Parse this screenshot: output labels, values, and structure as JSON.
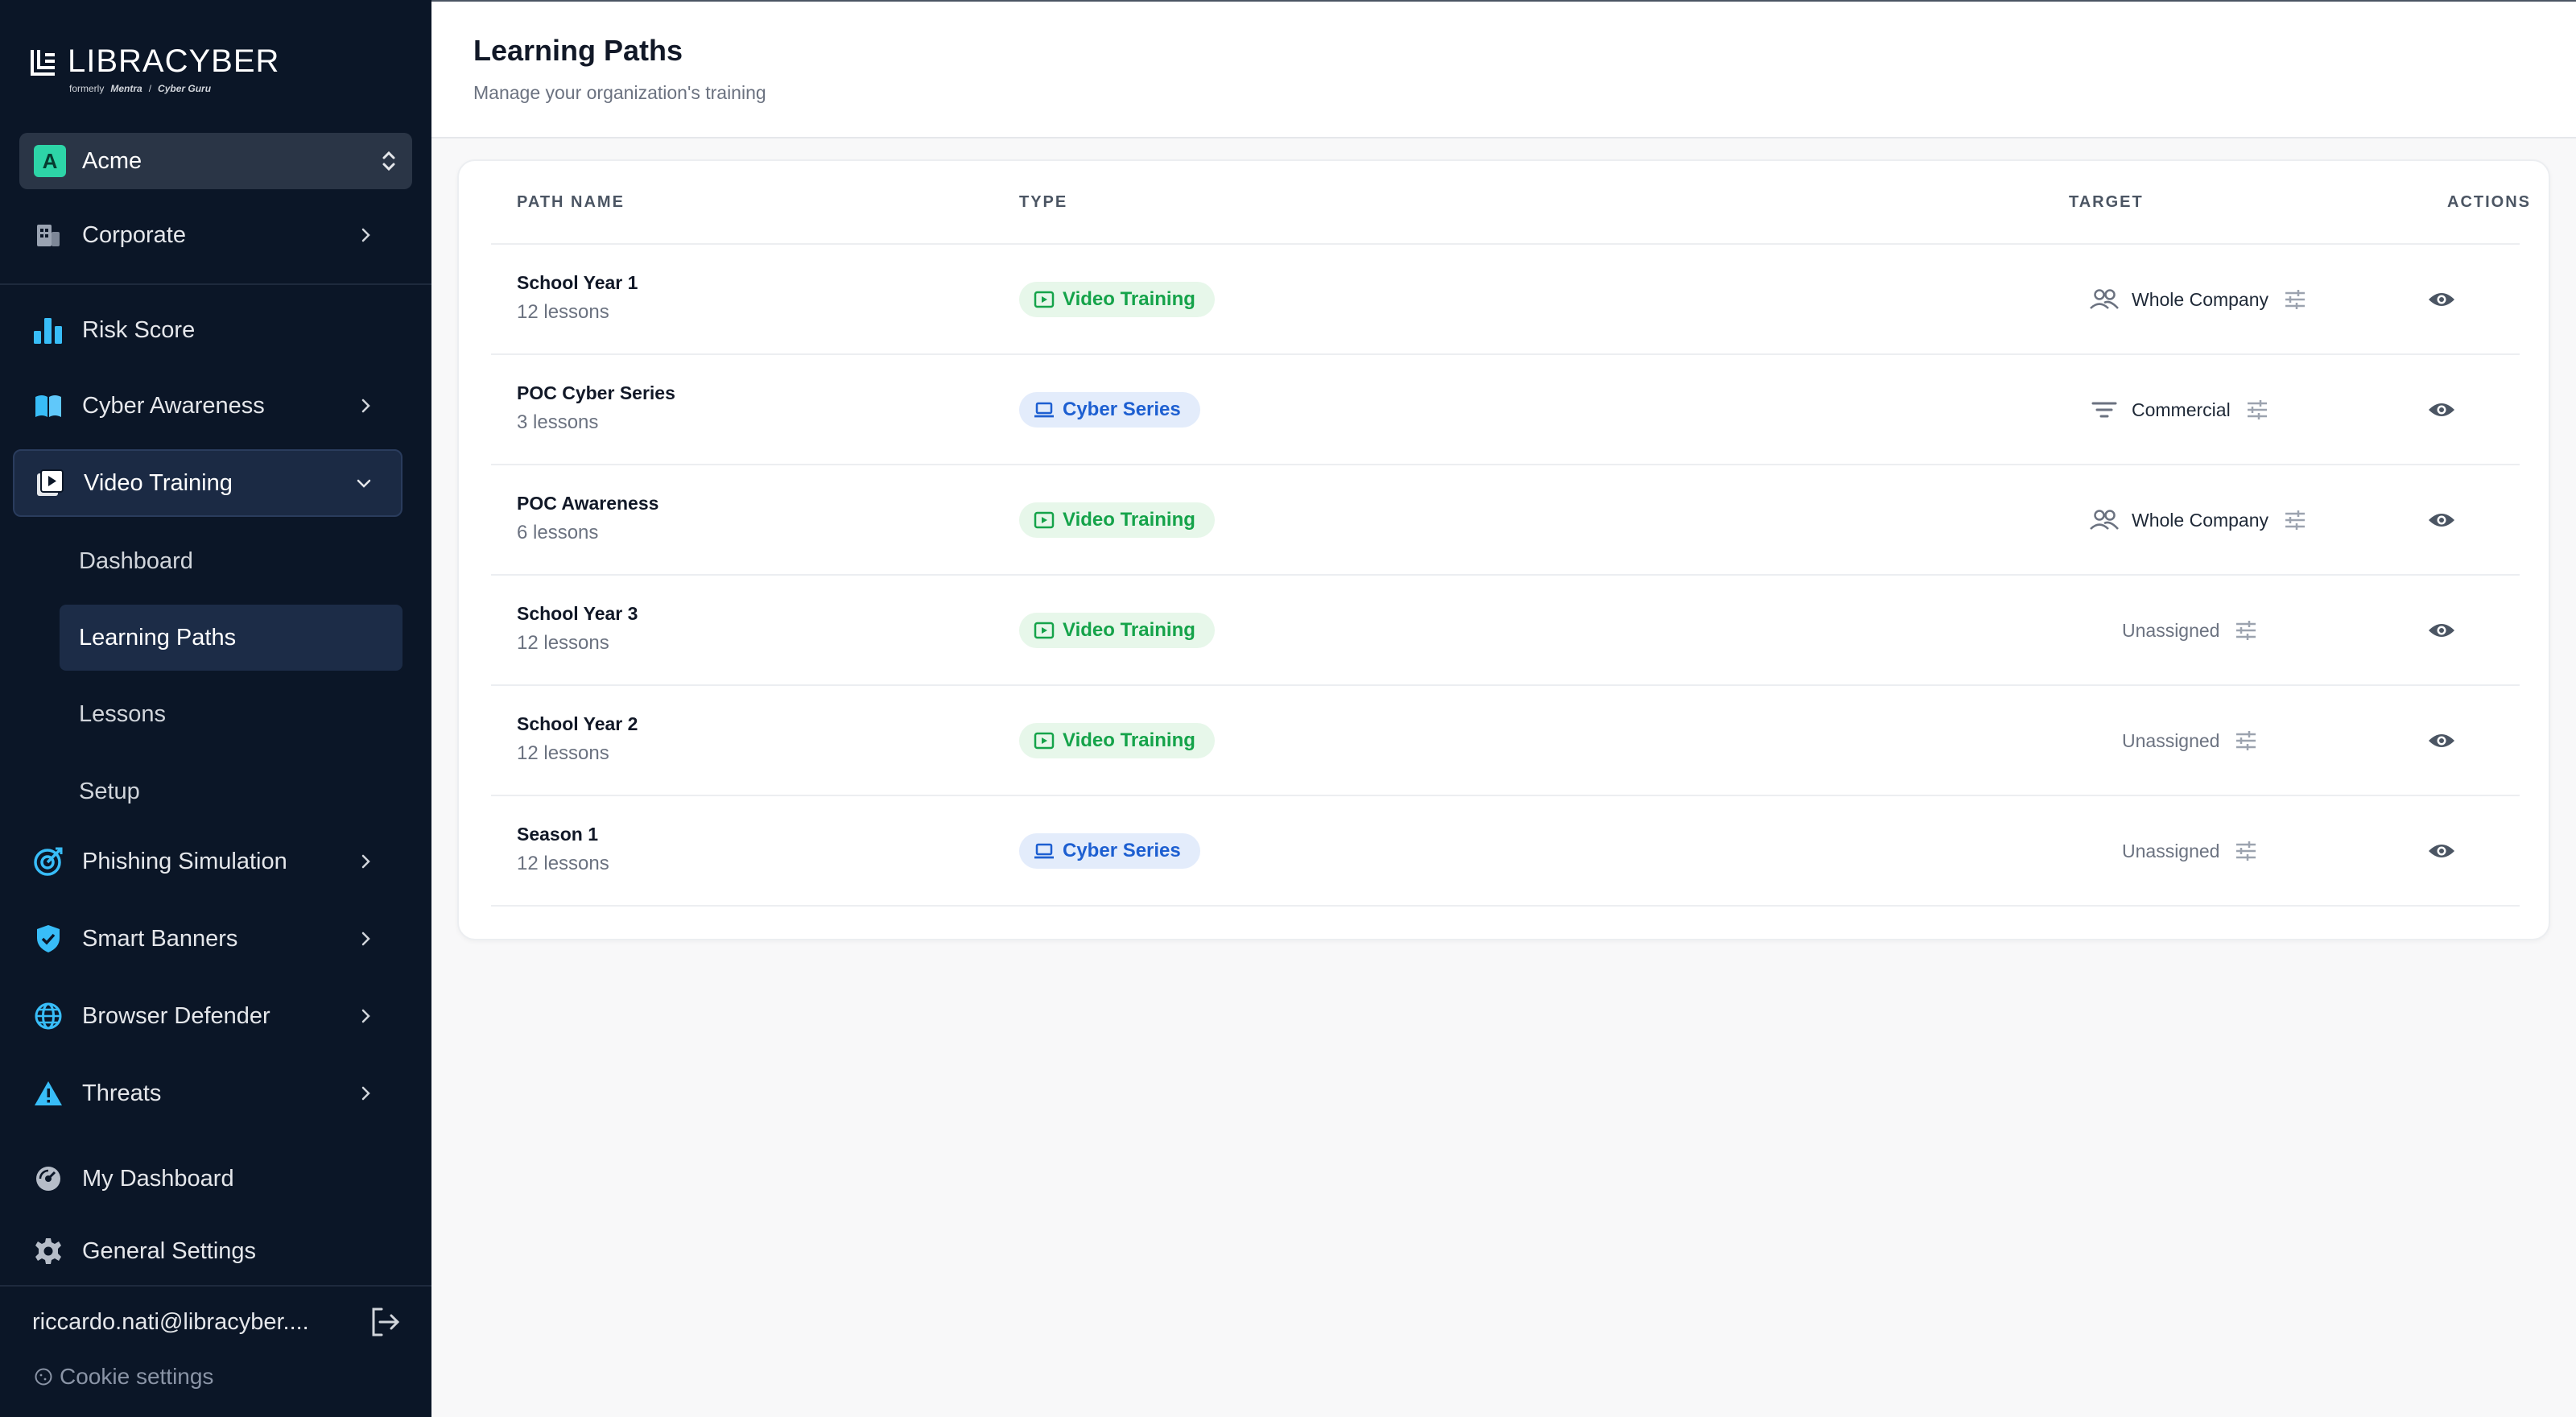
{
  "brand": {
    "name": "LIBRACYBER",
    "formerly": "formerly",
    "former_1": "Mentra",
    "separator": "/",
    "former_2": "Cyber Guru"
  },
  "org": {
    "initial": "A",
    "name": "Acme"
  },
  "nav": {
    "corporate": "Corporate",
    "risk_score": "Risk Score",
    "cyber_awareness": "Cyber Awareness",
    "video_training": "Video Training",
    "sub": {
      "dashboard": "Dashboard",
      "learning_paths": "Learning Paths",
      "lessons": "Lessons",
      "setup": "Setup"
    },
    "phishing": "Phishing Simulation",
    "smart_banners": "Smart Banners",
    "browser_defender": "Browser Defender",
    "threats": "Threats",
    "my_dashboard": "My Dashboard",
    "general_settings": "General Settings"
  },
  "user": {
    "email": "riccardo.nati@libracyber....",
    "cookie": "Cookie settings"
  },
  "page": {
    "title": "Learning Paths",
    "subtitle": "Manage your organization's training"
  },
  "table": {
    "headers": {
      "name": "PATH NAME",
      "type": "TYPE",
      "target": "TARGET",
      "actions": "ACTIONS"
    },
    "rows": [
      {
        "name": "School Year 1",
        "lessons": "12 lessons",
        "type": "Video Training",
        "target": "Whole Company"
      },
      {
        "name": "POC Cyber Series",
        "lessons": "3 lessons",
        "type": "Cyber Series",
        "target": "Commercial"
      },
      {
        "name": "POC Awareness",
        "lessons": "6 lessons",
        "type": "Video Training",
        "target": "Whole Company"
      },
      {
        "name": "School Year 3",
        "lessons": "12 lessons",
        "type": "Video Training",
        "target": "Unassigned"
      },
      {
        "name": "School Year 2",
        "lessons": "12 lessons",
        "type": "Video Training",
        "target": "Unassigned"
      },
      {
        "name": "Season 1",
        "lessons": "12 lessons",
        "type": "Cyber Series",
        "target": "Unassigned"
      }
    ]
  },
  "colors": {
    "sidebar_bg": "#0b1627",
    "accent_cyan": "#38bdf8",
    "video_green": "#15a34a",
    "cyber_blue": "#1d5fd1"
  }
}
